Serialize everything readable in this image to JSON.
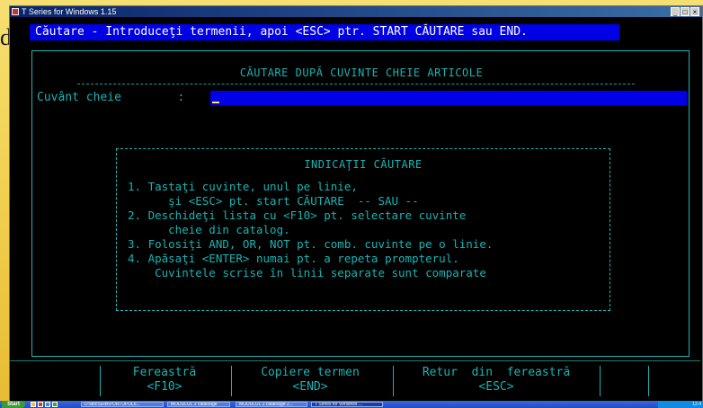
{
  "window": {
    "title": "T Series for Windows 1.15",
    "controls": [
      "_",
      "□",
      "×"
    ]
  },
  "prompt": "Căutare - Introduceţi termenii, apoi <ESC> ptr. START CĂUTARE sau END.",
  "search": {
    "heading": "CĂUTARE DUPĂ CUVINTE CHEIE ARTICOLE",
    "keyword_label": "Cuvânt cheie        :",
    "keyword_value": ""
  },
  "hints": {
    "title": "INDICAŢII CĂUTARE",
    "lines": [
      "1. Tastaţi cuvinte, unul pe linie,",
      "      şi <ESC> pt. start CĂUTARE  -- SAU --",
      "2. Deschideţi lista cu <F10> pt. selectare cuvinte",
      "      cheie din catalog.",
      "3. Folosiţi AND, OR, NOT pt. comb. cuvinte pe o linie.",
      "4. Apăsaţi <ENTER> numai pt. a repeta prompterul.",
      "    Cuvintele scrise în linii separate sunt comparate"
    ]
  },
  "function_keys": [
    {
      "label": "Fereastră",
      "key": "<F10>"
    },
    {
      "label": "Copiere termen",
      "key": "<END>"
    },
    {
      "label": "Retur  din  fereastră",
      "key": "<ESC>"
    }
  ],
  "taskbar": {
    "start_label": "Start",
    "items": [
      "D:\\doc\\SRB\\PORTOFOLII...",
      "MODULUL 3 cataloage",
      "MODULUL 3 cataloage 2...",
      "T Series for Windows ..."
    ],
    "clock": "12:4"
  }
}
